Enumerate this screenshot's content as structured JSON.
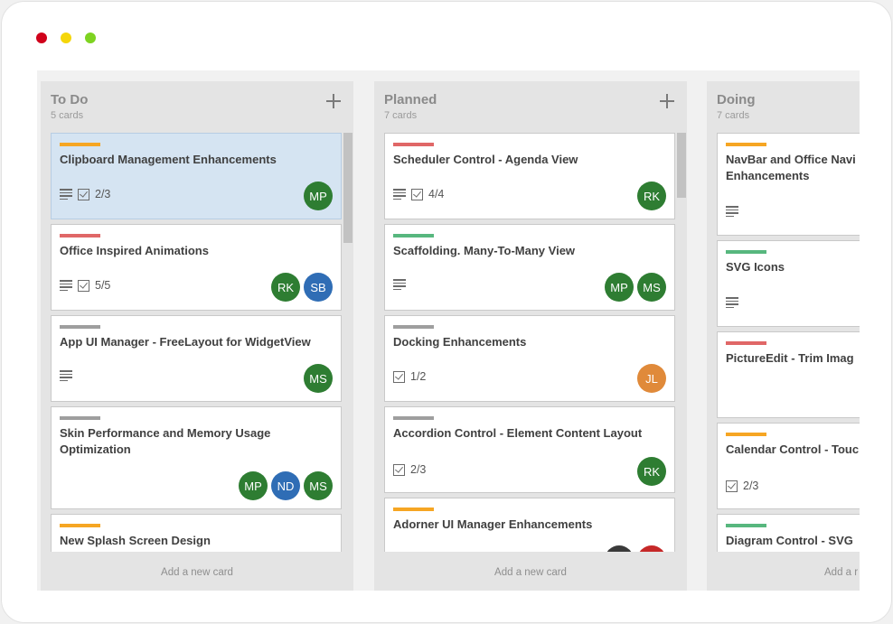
{
  "window": {
    "controls": [
      "close",
      "minimize",
      "maximize"
    ],
    "control_colors": [
      "#d0021b",
      "#f5d60a",
      "#7ed321"
    ]
  },
  "colors": {
    "orange": "#f6a623",
    "red": "#e06767",
    "green": "#57b77e",
    "gray": "#9e9e9e",
    "avatar_green": "#2e7d32",
    "avatar_blue": "#2f6db5",
    "avatar_orange": "#e08a3a",
    "avatar_dark": "#3a3a3a",
    "avatar_red": "#c62828"
  },
  "columns": [
    {
      "title": "To Do",
      "count": "5 cards",
      "add_card": "Add a new card",
      "cards": [
        {
          "title": "Clipboard Management Enhancements",
          "stripe": "orange",
          "desc_icon": "description-icon",
          "checklist": "2/3",
          "avatars": [
            "MP"
          ]
        },
        {
          "title": "Office Inspired Animations",
          "stripe": "red",
          "desc_icon": "description-icon",
          "checklist": "5/5",
          "avatars": [
            "RK",
            "SB"
          ]
        },
        {
          "title": "App UI Manager - FreeLayout for WidgetView",
          "stripe": "gray",
          "desc_icon": "description-icon",
          "avatars": [
            "MS"
          ]
        },
        {
          "title": "Skin Performance and Memory Usage Optimization",
          "stripe": "gray",
          "avatars": [
            "MP",
            "ND",
            "MS"
          ]
        },
        {
          "title": "New Splash Screen Design",
          "stripe": "orange"
        }
      ]
    },
    {
      "title": "Planned",
      "count": "7 cards",
      "add_card": "Add a new card",
      "cards": [
        {
          "title": "Scheduler Control - Agenda View",
          "stripe": "red",
          "desc_icon": "description-icon",
          "checklist": "4/4",
          "avatars": [
            "RK"
          ]
        },
        {
          "title": "Scaffolding. Many-To-Many View",
          "stripe": "green",
          "desc_icon": "description-icon",
          "avatars": [
            "MP",
            "MS"
          ]
        },
        {
          "title": "Docking Enhancements",
          "stripe": "gray",
          "checklist": "1/2",
          "avatars": [
            "JL"
          ]
        },
        {
          "title": "Accordion Control - Element Content Layout",
          "stripe": "gray",
          "checklist": "2/3",
          "avatars": [
            "RK"
          ]
        },
        {
          "title": "Adorner UI Manager Enhancements",
          "stripe": "orange"
        }
      ]
    },
    {
      "title": "Doing",
      "count": "7 cards",
      "add_card": "Add a r",
      "cards": [
        {
          "title": "NavBar and Office Navi Enhancements",
          "stripe": "orange",
          "desc_icon": "description-icon"
        },
        {
          "title": "SVG Icons",
          "stripe": "green",
          "desc_icon": "description-icon"
        },
        {
          "title": "PictureEdit - Trim Imag",
          "stripe": "red"
        },
        {
          "title": "Calendar Control - Touc",
          "stripe": "orange",
          "checklist": "2/3"
        },
        {
          "title": "Diagram Control - SVG",
          "stripe": "green"
        }
      ]
    }
  ]
}
